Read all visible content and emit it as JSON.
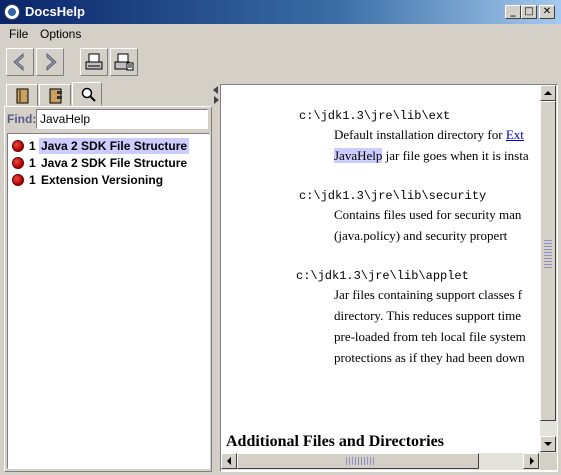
{
  "window": {
    "title": "DocsHelp",
    "minimize_glyph": "_",
    "maximize_glyph": "□",
    "close_glyph": "✕"
  },
  "menu": {
    "file": "File",
    "options": "Options"
  },
  "toolbar": {
    "buttons": [
      "back-icon",
      "forward-icon",
      "print-icon",
      "page-setup-icon"
    ]
  },
  "navigator": {
    "tabs": [
      "toc-book-icon",
      "index-icon",
      "search-magnifier-icon"
    ],
    "find_label": "Find:",
    "find_value": "JavaHelp",
    "results": [
      {
        "rank": "1",
        "title": "Java 2 SDK File Structure",
        "selected": true
      },
      {
        "rank": "1",
        "title": "Java 2 SDK File Structure",
        "selected": false
      },
      {
        "rank": "1",
        "title": "Extension Versioning",
        "selected": false
      }
    ]
  },
  "document": {
    "entries": [
      {
        "path": "c:\\jdk1.3\\jre\\lib\\ext",
        "lines": [
          "Default installation directory for ",
          "Ext"
        ],
        "line2_highlight": "JavaHelp",
        "line2_rest": " jar file goes when it is insta"
      },
      {
        "path": "c:\\jdk1.3\\jre\\lib\\security",
        "lines": [
          "Contains files used for security man",
          "(java.policy) and security propert"
        ]
      },
      {
        "path": "c:\\jdk1.3\\jre\\lib\\applet",
        "lines": [
          "Jar files containing support classes f",
          "directory. This reduces support time",
          "pre-loaded from teh local file system",
          "protections as if they had been down"
        ]
      }
    ],
    "heading": "Additional Files and Directories"
  },
  "colors": {
    "title_gradient_start": "#0a246a",
    "selection": "#ccccff",
    "link": "#0000cc",
    "result_marker": "#cc0000"
  }
}
